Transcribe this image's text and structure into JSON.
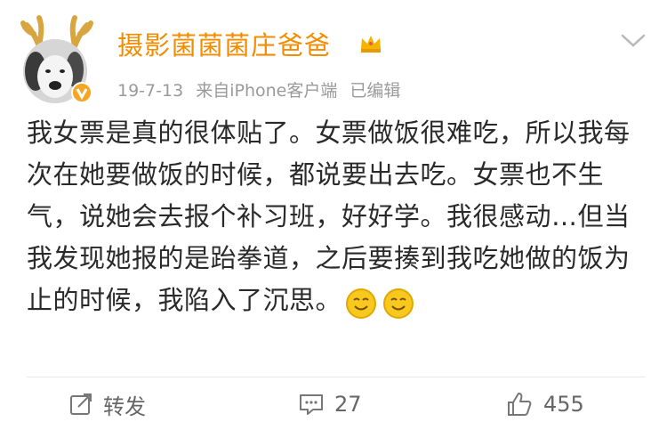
{
  "post": {
    "username": "摄影菌菌菌庄爸爸",
    "date": "19-7-13",
    "source": "来自iPhone客户端",
    "edited": "已编辑",
    "text": "我女票是真的很体贴了。女票做饭很难吃，所以我每次在她要做饭的时候，都说要出去吃。女票也不生气，说她会去报个补习班，好好学。我很感动…但当我发现她报的是跆拳道，之后要揍到我吃她做的饭为止的时候，我陷入了沉思。",
    "emojis": [
      "smile-emoji",
      "smile-emoji"
    ]
  },
  "actions": {
    "repost_label": "转发",
    "comment_count": "27",
    "like_count": "455"
  },
  "icons": {
    "avatar": "puppy-with-antlers-avatar",
    "verified": "verified-badge-icon",
    "vip": "crown-icon",
    "menu": "chevron-down-icon",
    "repost": "repost-icon",
    "comment": "comment-icon",
    "like": "thumbs-up-icon"
  },
  "colors": {
    "username": "#f28c00",
    "meta": "#9a9a9a",
    "text": "#2a2a2a",
    "badge": "#f5a623"
  }
}
